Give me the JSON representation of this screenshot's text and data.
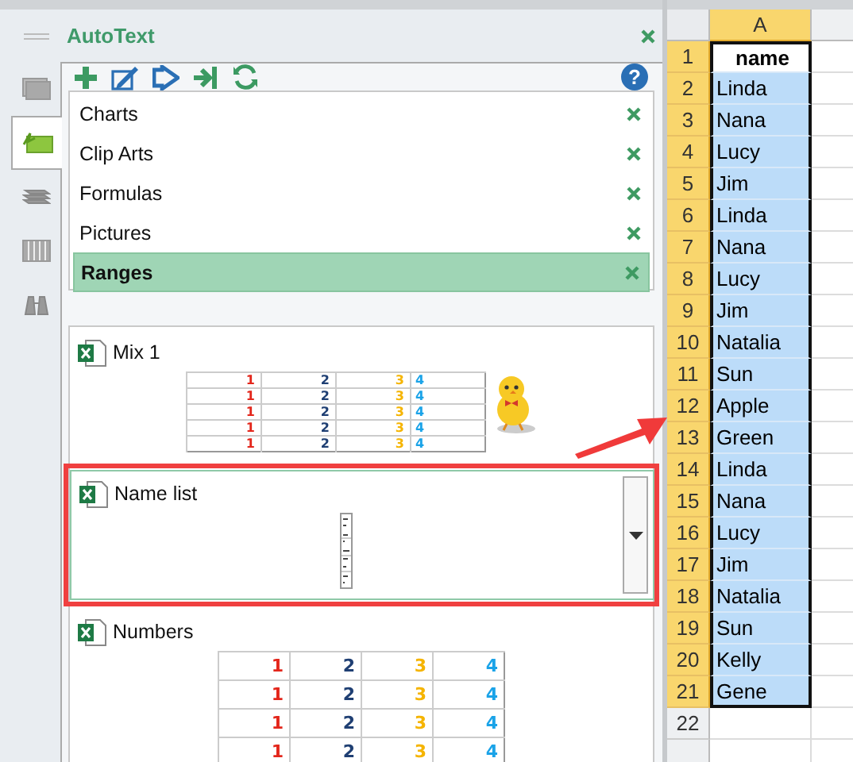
{
  "pane": {
    "title": "AutoText",
    "side_tabs": [
      {
        "kind": "window",
        "selected": false
      },
      {
        "kind": "autotext",
        "selected": true
      },
      {
        "kind": "stack",
        "selected": false
      },
      {
        "kind": "columns",
        "selected": false
      },
      {
        "kind": "binoculars",
        "selected": false
      }
    ],
    "toolbar": [
      {
        "kind": "add"
      },
      {
        "kind": "edit"
      },
      {
        "kind": "insert"
      },
      {
        "kind": "jump"
      },
      {
        "kind": "refresh"
      }
    ],
    "help_label": "?",
    "categories": [
      {
        "label": "Charts",
        "selected": false
      },
      {
        "label": "Clip Arts",
        "selected": false
      },
      {
        "label": "Formulas",
        "selected": false
      },
      {
        "label": "Pictures",
        "selected": false
      },
      {
        "label": "Ranges",
        "selected": true
      }
    ],
    "entries": [
      {
        "name": "Mix 1",
        "kind": "mix",
        "selected": false,
        "preview_rows": [
          [
            "1",
            "2",
            "3",
            "4"
          ],
          [
            "1",
            "2",
            "3",
            "4"
          ],
          [
            "1",
            "2",
            "3",
            "4"
          ],
          [
            "1",
            "2",
            "3",
            "4"
          ],
          [
            "1",
            "2",
            "3",
            "4"
          ]
        ]
      },
      {
        "name": "Name list",
        "kind": "names",
        "selected": true
      },
      {
        "name": "Numbers",
        "kind": "table",
        "selected": false,
        "preview_rows": [
          [
            "1",
            "2",
            "3",
            "4"
          ],
          [
            "1",
            "2",
            "3",
            "4"
          ],
          [
            "1",
            "2",
            "3",
            "4"
          ],
          [
            "1",
            "2",
            "3",
            "4"
          ]
        ]
      }
    ]
  },
  "sheet": {
    "column_header": {
      "label": "A",
      "selected": true
    },
    "rows": [
      {
        "number": "1",
        "value": "name",
        "selected": true,
        "active": true
      },
      {
        "number": "2",
        "value": "Linda",
        "selected": true,
        "active": false
      },
      {
        "number": "3",
        "value": "Nana",
        "selected": true,
        "active": false
      },
      {
        "number": "4",
        "value": "Lucy",
        "selected": true,
        "active": false
      },
      {
        "number": "5",
        "value": "Jim",
        "selected": true,
        "active": false
      },
      {
        "number": "6",
        "value": "Linda",
        "selected": true,
        "active": false
      },
      {
        "number": "7",
        "value": "Nana",
        "selected": true,
        "active": false
      },
      {
        "number": "8",
        "value": "Lucy",
        "selected": true,
        "active": false
      },
      {
        "number": "9",
        "value": "Jim",
        "selected": true,
        "active": false
      },
      {
        "number": "10",
        "value": "Natalia",
        "selected": true,
        "active": false
      },
      {
        "number": "11",
        "value": "Sun",
        "selected": true,
        "active": false
      },
      {
        "number": "12",
        "value": "Apple",
        "selected": true,
        "active": false
      },
      {
        "number": "13",
        "value": "Green",
        "selected": true,
        "active": false
      },
      {
        "number": "14",
        "value": "Linda",
        "selected": true,
        "active": false
      },
      {
        "number": "15",
        "value": "Nana",
        "selected": true,
        "active": false
      },
      {
        "number": "16",
        "value": "Lucy",
        "selected": true,
        "active": false
      },
      {
        "number": "17",
        "value": "Jim",
        "selected": true,
        "active": false
      },
      {
        "number": "18",
        "value": "Natalia",
        "selected": true,
        "active": false
      },
      {
        "number": "19",
        "value": "Sun",
        "selected": true,
        "active": false
      },
      {
        "number": "20",
        "value": "Kelly",
        "selected": true,
        "active": false
      },
      {
        "number": "21",
        "value": "Gene",
        "selected": true,
        "active": false
      },
      {
        "number": "22",
        "selected": false,
        "active": false
      }
    ]
  }
}
